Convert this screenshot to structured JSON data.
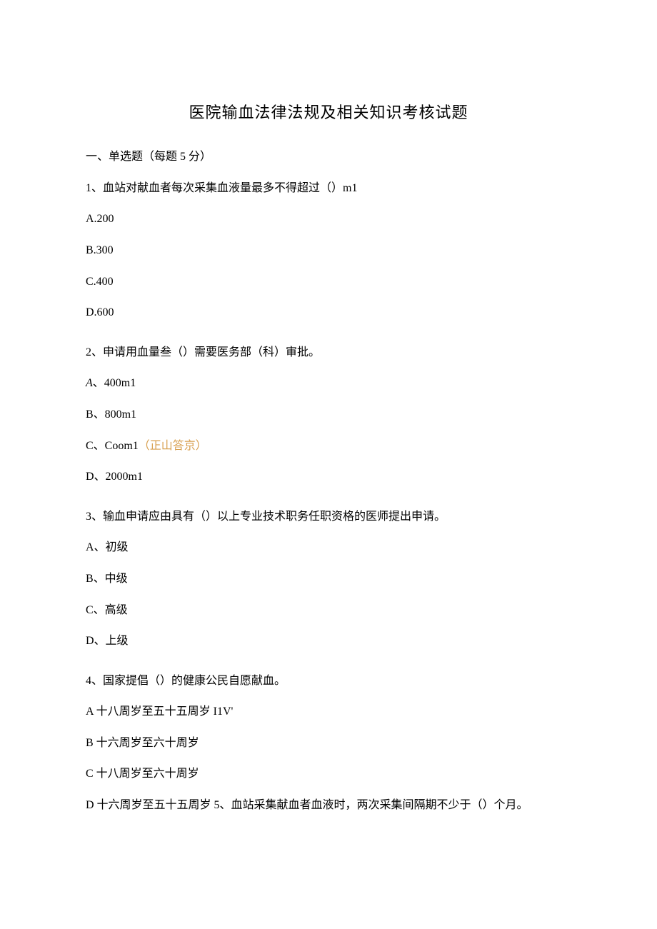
{
  "title": "医院输血法律法规及相关知识考核试题",
  "section1_header": "一、单选题（每题 5 分）",
  "q1": {
    "stem": "1、血站对献血者每次采集血液量最多不得超过（）m1",
    "a": "A.200",
    "b": "B.300",
    "c": "C.400",
    "d": "D.600"
  },
  "q2": {
    "stem": "2、申请用血量叁（）需要医务部（科）审批。",
    "a_prefix": "A",
    "a_rest": "、400m1",
    "b": "B、800m1",
    "c_main": "C、Coom1",
    "c_hint": "（正山答京）",
    "d": "D、2000m1"
  },
  "q3": {
    "stem": "3、输血申请应由具有（）以上专业技术职务任职资格的医师提出申请。",
    "a": "A、初级",
    "b": "B、中级",
    "c": "C、高级",
    "d": "D、上级"
  },
  "q4": {
    "stem": "4、国家提倡（）的健康公民自愿献血。",
    "a": "A 十八周岁至五十五周岁 I1V'",
    "b": "B 十六周岁至六十周岁",
    "c": "C 十八周岁至六十周岁",
    "d": "D 十六周岁至五十五周岁 5、血站采集献血者血液时，两次采集间隔期不少于（）个月。"
  }
}
